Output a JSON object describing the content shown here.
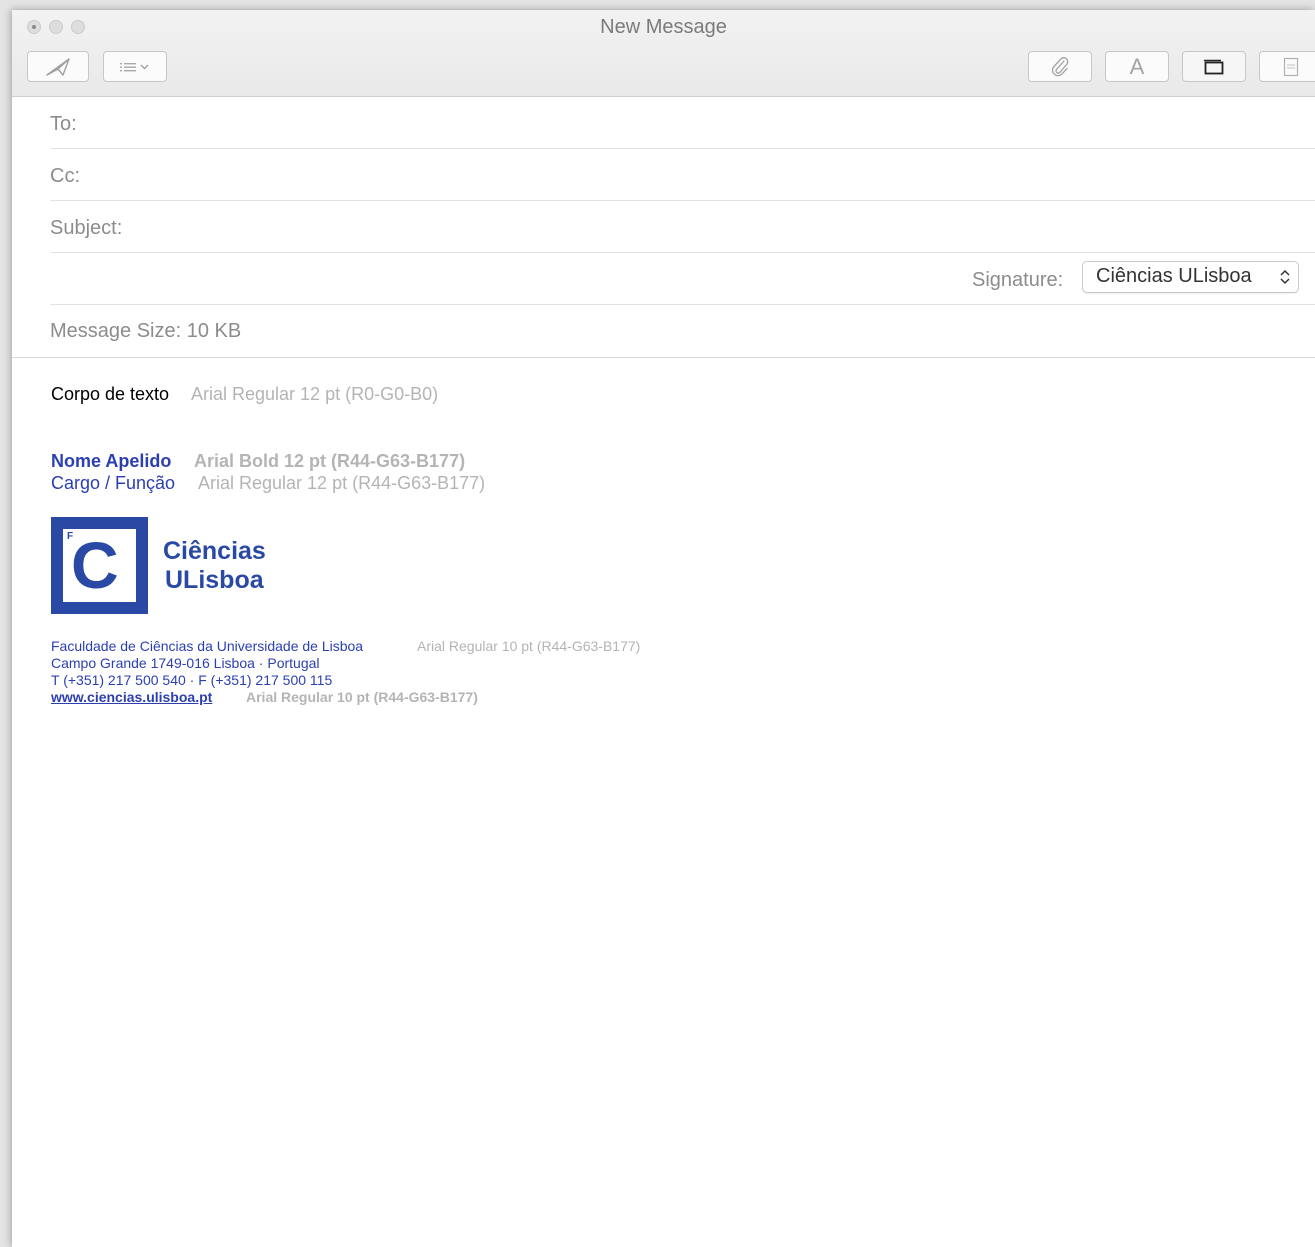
{
  "window": {
    "title": "New Message"
  },
  "toolbar": {
    "send_icon": "paper-plane-icon",
    "format_icon": "list-dropdown-icon",
    "attach_icon": "paperclip-icon",
    "font_label": "A",
    "photo_browser_icon": "window-icon",
    "stationery_icon": "stationery-icon"
  },
  "fields": {
    "to_label": "To:",
    "cc_label": "Cc:",
    "subject_label": "Subject:",
    "signature_label": "Signature:",
    "signature_value": "Ciências ULisboa",
    "message_size": "Message Size: 10 KB"
  },
  "body": {
    "line1_text": "Corpo de texto",
    "line1_note": "Arial Regular 12 pt  (R0-G0-B0)",
    "name_text": "Nome Apelido",
    "name_note": "Arial Bold 12 pt  (R44-G63-B177)",
    "role_text": "Cargo / Função",
    "role_note": "Arial Regular 12 pt  (R44-G63-B177)",
    "logo": {
      "letter": "C",
      "superscript": "F",
      "line1": "Ciências",
      "line2": "ULisboa"
    },
    "address1": "Faculdade de Ciências da Universidade de Lisboa",
    "address1_note": "Arial Regular 10 pt  (R44-G63-B177)",
    "address2": "Campo Grande 1749-016 Lisboa · Portugal",
    "phone": "T (+351) 217 500 540 · F (+351) 217 500 115",
    "website": "www.ciencias.ulisboa.pt",
    "website_note": "Arial Regular 10 pt  (R44-G63-B177)"
  },
  "colors": {
    "signature_blue": "#2c3fb1",
    "note_gray": "#b4b4b4"
  }
}
